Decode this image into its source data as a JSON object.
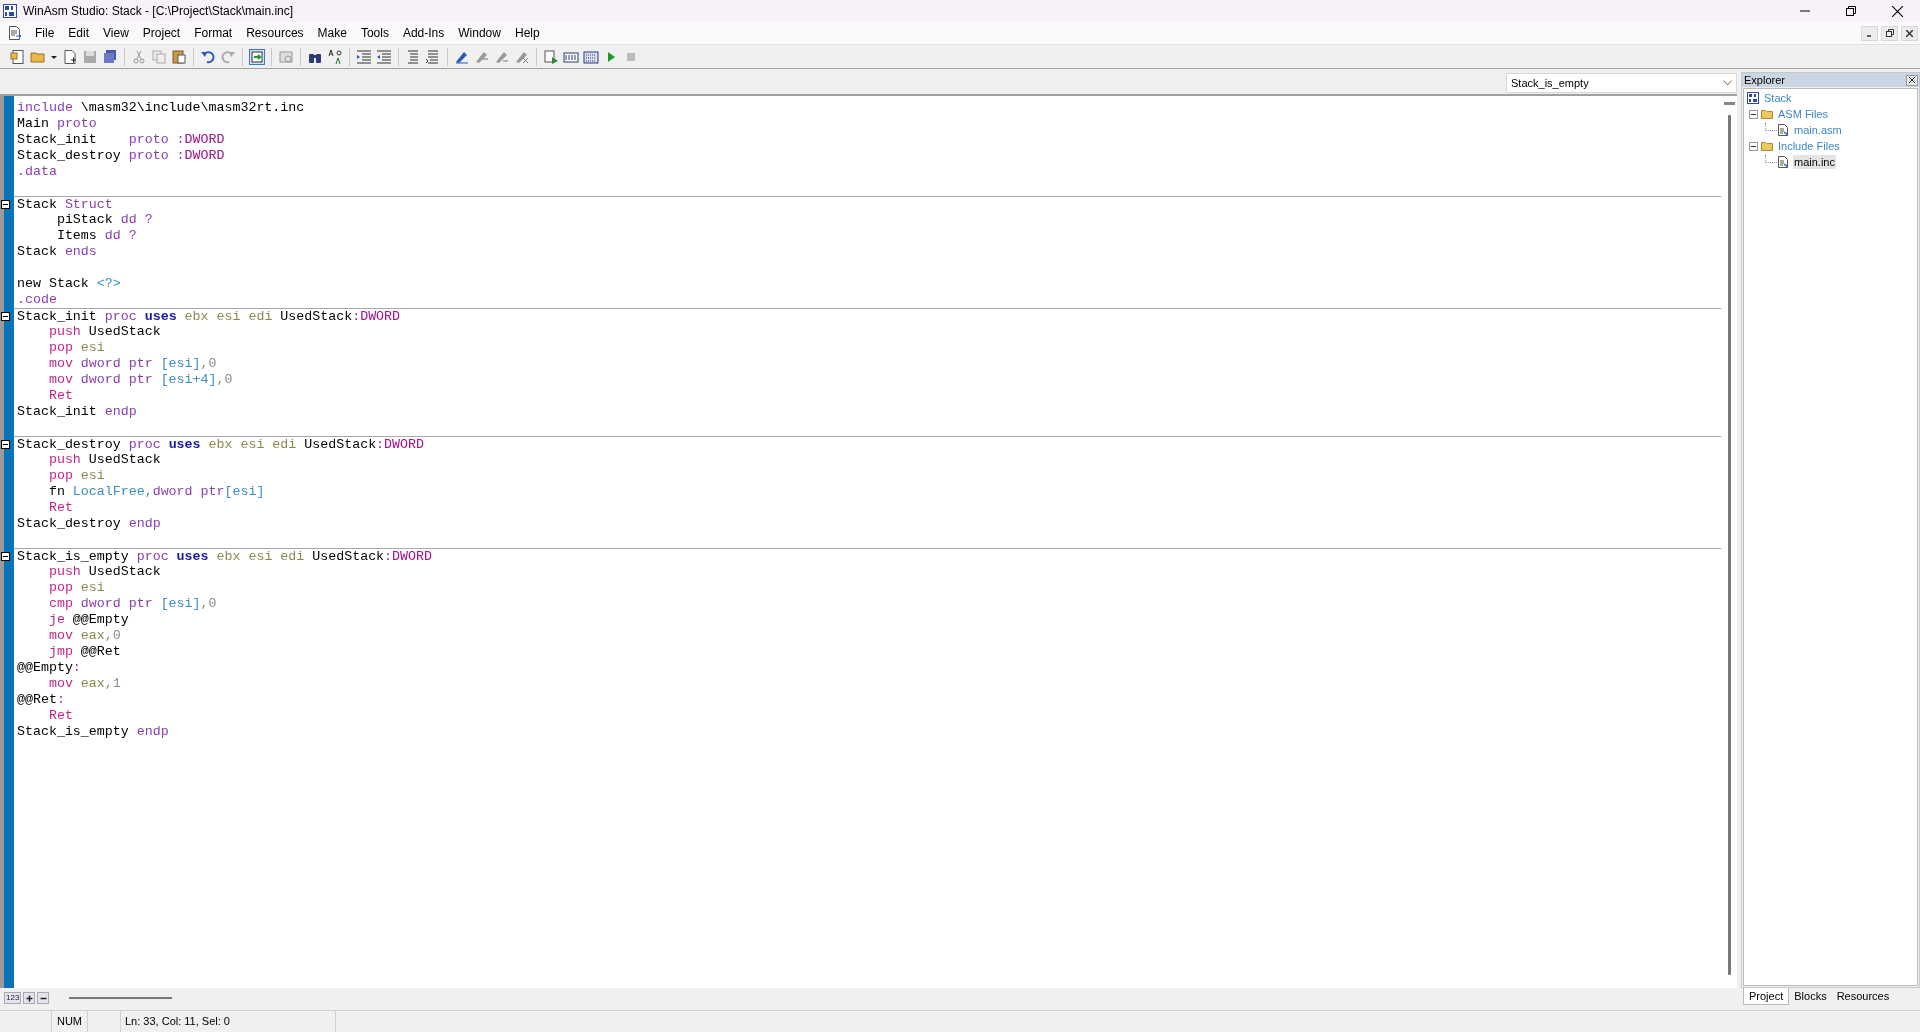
{
  "window": {
    "title": "WinAsm Studio: Stack - [C:\\Project\\Stack\\main.inc]"
  },
  "menu": [
    "File",
    "Edit",
    "View",
    "Project",
    "Format",
    "Resources",
    "Make",
    "Tools",
    "Add-Ins",
    "Window",
    "Help"
  ],
  "function_list": {
    "value": "Stack_is_empty"
  },
  "editor": {
    "lines": [
      {
        "fold": false,
        "tokens": [
          {
            "text": "include",
            "kind": "directive"
          },
          {
            "text": " \\masm32\\include\\masm32rt.inc",
            "kind": "plain"
          }
        ]
      },
      {
        "fold": false,
        "tokens": [
          {
            "text": "Main ",
            "kind": "plain"
          },
          {
            "text": "proto",
            "kind": "directive"
          }
        ]
      },
      {
        "fold": false,
        "tokens": [
          {
            "text": "Stack_init    ",
            "kind": "plain"
          },
          {
            "text": "proto :",
            "kind": "directive"
          },
          {
            "text": "DWORD",
            "kind": "type"
          }
        ]
      },
      {
        "fold": false,
        "tokens": [
          {
            "text": "Stack_destroy ",
            "kind": "plain"
          },
          {
            "text": "proto :",
            "kind": "directive"
          },
          {
            "text": "DWORD",
            "kind": "type"
          }
        ]
      },
      {
        "fold": false,
        "tokens": [
          {
            "text": ".data",
            "kind": "directive"
          }
        ]
      },
      {
        "fold": false
      },
      {
        "fold": true,
        "tokens": [
          {
            "text": "Stack ",
            "kind": "plain"
          },
          {
            "text": "Struct",
            "kind": "directive"
          }
        ]
      },
      {
        "fold": false,
        "tokens": [
          {
            "text": "     piStack ",
            "kind": "plain"
          },
          {
            "text": "dd ?",
            "kind": "directive"
          }
        ]
      },
      {
        "fold": false,
        "tokens": [
          {
            "text": "     Items ",
            "kind": "plain"
          },
          {
            "text": "dd ?",
            "kind": "directive"
          }
        ]
      },
      {
        "fold": false,
        "tokens": [
          {
            "text": "Stack ",
            "kind": "plain"
          },
          {
            "text": "ends",
            "kind": "directive"
          }
        ]
      },
      {
        "fold": false
      },
      {
        "fold": false,
        "tokens": [
          {
            "text": "new Stack ",
            "kind": "plain"
          },
          {
            "text": "<?>",
            "kind": "operand"
          }
        ]
      },
      {
        "fold": false,
        "tokens": [
          {
            "text": ".code",
            "kind": "directive"
          }
        ]
      },
      {
        "fold": true,
        "tokens": [
          {
            "text": "Stack_init ",
            "kind": "plain"
          },
          {
            "text": "proc ",
            "kind": "directive"
          },
          {
            "text": "uses",
            "kind": "keyword"
          },
          {
            "text": " ebx esi edi",
            "kind": "register"
          },
          {
            "text": " UsedStack",
            "kind": "plain"
          },
          {
            "text": ":",
            "kind": "directive"
          },
          {
            "text": "DWORD",
            "kind": "type"
          }
        ]
      },
      {
        "fold": false,
        "tokens": [
          {
            "text": "    push",
            "kind": "instruction"
          },
          {
            "text": " UsedStack",
            "kind": "plain"
          }
        ]
      },
      {
        "fold": false,
        "tokens": [
          {
            "text": "    pop",
            "kind": "instruction"
          },
          {
            "text": " esi",
            "kind": "register"
          }
        ]
      },
      {
        "fold": false,
        "tokens": [
          {
            "text": "    mov",
            "kind": "instruction"
          },
          {
            "text": " dword ptr ",
            "kind": "directive"
          },
          {
            "text": "[esi]",
            "kind": "operand"
          },
          {
            "text": ",0",
            "kind": "number"
          }
        ]
      },
      {
        "fold": false,
        "tokens": [
          {
            "text": "    mov",
            "kind": "instruction"
          },
          {
            "text": " dword ptr ",
            "kind": "directive"
          },
          {
            "text": "[esi+4]",
            "kind": "operand"
          },
          {
            "text": ",0",
            "kind": "number"
          }
        ]
      },
      {
        "fold": false,
        "tokens": [
          {
            "text": "    Ret",
            "kind": "instruction"
          }
        ]
      },
      {
        "fold": false,
        "tokens": [
          {
            "text": "Stack_init ",
            "kind": "plain"
          },
          {
            "text": "endp",
            "kind": "directive"
          }
        ]
      },
      {
        "fold": false
      },
      {
        "fold": true,
        "tokens": [
          {
            "text": "Stack_destroy ",
            "kind": "plain"
          },
          {
            "text": "proc ",
            "kind": "directive"
          },
          {
            "text": "uses",
            "kind": "keyword"
          },
          {
            "text": " ebx esi edi",
            "kind": "register"
          },
          {
            "text": " UsedStack",
            "kind": "plain"
          },
          {
            "text": ":",
            "kind": "directive"
          },
          {
            "text": "DWORD",
            "kind": "type"
          }
        ]
      },
      {
        "fold": false,
        "tokens": [
          {
            "text": "    push",
            "kind": "instruction"
          },
          {
            "text": " UsedStack",
            "kind": "plain"
          }
        ]
      },
      {
        "fold": false,
        "tokens": [
          {
            "text": "    pop",
            "kind": "instruction"
          },
          {
            "text": " esi",
            "kind": "register"
          }
        ]
      },
      {
        "fold": false,
        "tokens": [
          {
            "text": "    fn ",
            "kind": "plain"
          },
          {
            "text": "LocalFree,",
            "kind": "operand"
          },
          {
            "text": "dword ptr",
            "kind": "directive"
          },
          {
            "text": "[esi]",
            "kind": "operand"
          }
        ]
      },
      {
        "fold": false,
        "tokens": [
          {
            "text": "    Ret",
            "kind": "instruction"
          }
        ]
      },
      {
        "fold": false,
        "tokens": [
          {
            "text": "Stack_destroy ",
            "kind": "plain"
          },
          {
            "text": "endp",
            "kind": "directive"
          }
        ]
      },
      {
        "fold": false
      },
      {
        "fold": true,
        "tokens": [
          {
            "text": "Stack_is_empty ",
            "kind": "plain"
          },
          {
            "text": "proc ",
            "kind": "directive"
          },
          {
            "text": "uses",
            "kind": "keyword"
          },
          {
            "text": " ebx esi edi",
            "kind": "register"
          },
          {
            "text": " UsedStack",
            "kind": "plain"
          },
          {
            "text": ":",
            "kind": "directive"
          },
          {
            "text": "DWORD",
            "kind": "type"
          }
        ]
      },
      {
        "fold": false,
        "tokens": [
          {
            "text": "    push",
            "kind": "instruction"
          },
          {
            "text": " UsedStack",
            "kind": "plain"
          }
        ]
      },
      {
        "fold": false,
        "tokens": [
          {
            "text": "    pop",
            "kind": "instruction"
          },
          {
            "text": " esi",
            "kind": "register"
          }
        ]
      },
      {
        "fold": false,
        "tokens": [
          {
            "text": "    cmp",
            "kind": "instruction"
          },
          {
            "text": " dword ptr ",
            "kind": "directive"
          },
          {
            "text": "[esi]",
            "kind": "operand"
          },
          {
            "text": ",0",
            "kind": "number"
          }
        ]
      },
      {
        "fold": false,
        "tokens": [
          {
            "text": "    je",
            "kind": "instruction"
          },
          {
            "text": " @@Empty",
            "kind": "plain"
          }
        ]
      },
      {
        "fold": false,
        "tokens": [
          {
            "text": "    mov",
            "kind": "instruction"
          },
          {
            "text": " eax,",
            "kind": "register"
          },
          {
            "text": "0",
            "kind": "number"
          }
        ]
      },
      {
        "fold": false,
        "tokens": [
          {
            "text": "    jmp",
            "kind": "instruction"
          },
          {
            "text": " @@Ret",
            "kind": "plain"
          }
        ]
      },
      {
        "fold": false,
        "tokens": [
          {
            "text": "@@Empty",
            "kind": "plain"
          },
          {
            "text": ":",
            "kind": "directive"
          }
        ]
      },
      {
        "fold": false,
        "tokens": [
          {
            "text": "    mov",
            "kind": "instruction"
          },
          {
            "text": " eax,",
            "kind": "register"
          },
          {
            "text": "1",
            "kind": "number"
          }
        ]
      },
      {
        "fold": false,
        "tokens": [
          {
            "text": "@@Ret",
            "kind": "plain"
          },
          {
            "text": ":",
            "kind": "directive"
          }
        ]
      },
      {
        "fold": false,
        "tokens": [
          {
            "text": "    Ret",
            "kind": "instruction"
          }
        ]
      },
      {
        "fold": false,
        "tokens": [
          {
            "text": "Stack_is_empty ",
            "kind": "plain"
          },
          {
            "text": "endp",
            "kind": "directive"
          }
        ]
      }
    ]
  },
  "editor_footer": {
    "line_numbers_button": "123"
  },
  "explorer": {
    "title": "Explorer",
    "tree": [
      {
        "label": "Stack",
        "kind": "project",
        "selected": false,
        "children": [
          {
            "label": "ASM Files",
            "kind": "folder",
            "expanded": true,
            "selected": false,
            "children": [
              {
                "label": "main.asm",
                "kind": "file",
                "selected": false
              }
            ]
          },
          {
            "label": "Include Files",
            "kind": "folder",
            "expanded": true,
            "selected": false,
            "children": [
              {
                "label": "main.inc",
                "kind": "file",
                "selected": true
              }
            ]
          }
        ]
      }
    ],
    "tabs": [
      {
        "label": "Project",
        "selected": true
      },
      {
        "label": "Blocks",
        "selected": false
      },
      {
        "label": "Resources",
        "selected": false
      }
    ]
  },
  "status_bar": {
    "keyboard": "NUM",
    "position": "Ln: 33, Col: 11, Sel: 0"
  }
}
